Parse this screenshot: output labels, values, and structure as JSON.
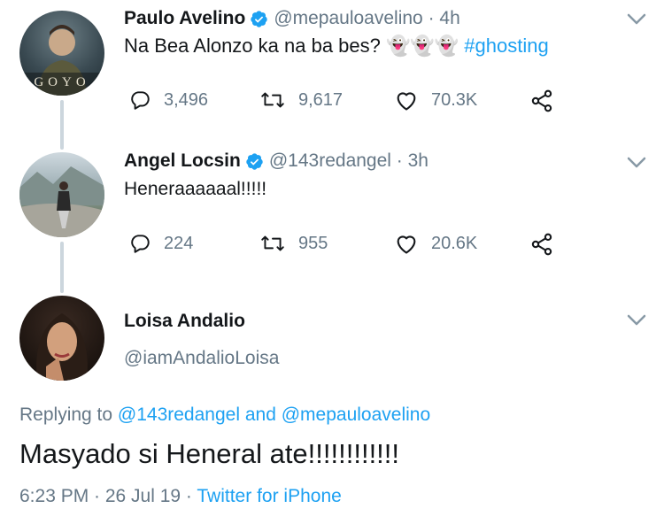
{
  "tweets": [
    {
      "name": "Paulo Avelino",
      "handle": "@mepauloavelino · 4h",
      "text_main": "Na Bea Alonzo ka na ba bes? 👻👻👻 ",
      "hashtag": "#ghosting",
      "avatar_text": "GOYO",
      "replies": "3,496",
      "retweets": "9,617",
      "likes": "70.3K"
    },
    {
      "name": "Angel Locsin",
      "handle": "@143redangel · 3h",
      "text": "Heneraaaaaal!!!!!",
      "replies": "224",
      "retweets": "955",
      "likes": "20.6K"
    }
  ],
  "focus": {
    "name": "Loisa Andalio",
    "handle": "@iamAndalioLoisa",
    "replying_prefix": "Replying to ",
    "replying_user1": "@143redangel",
    "replying_and": " and ",
    "replying_user2": "@mepauloavelino",
    "text": "Masyado si Heneral ate!!!!!!!!!!!!",
    "timestamp": "6:23 PM · 26 Jul 19 · ",
    "source": "Twitter for iPhone"
  },
  "colors": {
    "accent": "#1da1f2",
    "secondary_text": "#657786",
    "thread_line": "#ccd6dd"
  }
}
